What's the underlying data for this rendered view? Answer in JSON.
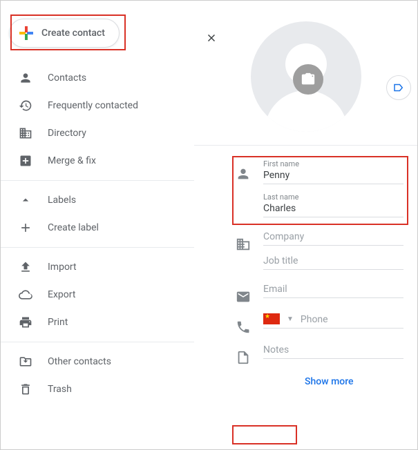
{
  "create_button": "Create contact",
  "nav": {
    "contacts": "Contacts",
    "frequently": "Frequently contacted",
    "directory": "Directory",
    "merge": "Merge & fix",
    "labels": "Labels",
    "create_label": "Create label",
    "import": "Import",
    "export": "Export",
    "print": "Print",
    "other": "Other contacts",
    "trash": "Trash"
  },
  "form": {
    "first_name_label": "First name",
    "first_name": "Penny",
    "last_name_label": "Last name",
    "last_name": "Charles",
    "company": "Company",
    "job_title": "Job title",
    "email": "Email",
    "phone": "Phone",
    "notes": "Notes",
    "show_more": "Show more"
  }
}
